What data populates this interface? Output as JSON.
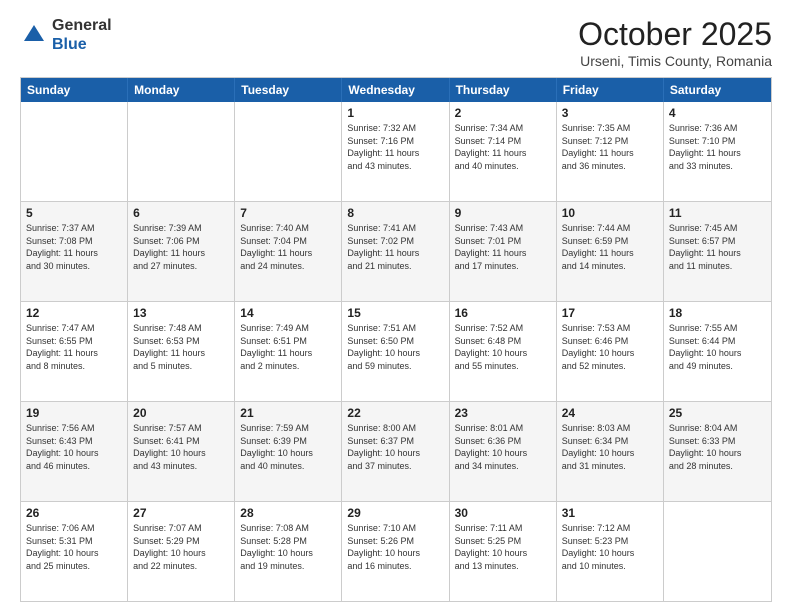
{
  "header": {
    "logo_general": "General",
    "logo_blue": "Blue",
    "title": "October 2025",
    "subtitle": "Urseni, Timis County, Romania"
  },
  "weekdays": [
    "Sunday",
    "Monday",
    "Tuesday",
    "Wednesday",
    "Thursday",
    "Friday",
    "Saturday"
  ],
  "weeks": [
    [
      {
        "day": "",
        "info": ""
      },
      {
        "day": "",
        "info": ""
      },
      {
        "day": "",
        "info": ""
      },
      {
        "day": "1",
        "info": "Sunrise: 7:32 AM\nSunset: 7:16 PM\nDaylight: 11 hours\nand 43 minutes."
      },
      {
        "day": "2",
        "info": "Sunrise: 7:34 AM\nSunset: 7:14 PM\nDaylight: 11 hours\nand 40 minutes."
      },
      {
        "day": "3",
        "info": "Sunrise: 7:35 AM\nSunset: 7:12 PM\nDaylight: 11 hours\nand 36 minutes."
      },
      {
        "day": "4",
        "info": "Sunrise: 7:36 AM\nSunset: 7:10 PM\nDaylight: 11 hours\nand 33 minutes."
      }
    ],
    [
      {
        "day": "5",
        "info": "Sunrise: 7:37 AM\nSunset: 7:08 PM\nDaylight: 11 hours\nand 30 minutes."
      },
      {
        "day": "6",
        "info": "Sunrise: 7:39 AM\nSunset: 7:06 PM\nDaylight: 11 hours\nand 27 minutes."
      },
      {
        "day": "7",
        "info": "Sunrise: 7:40 AM\nSunset: 7:04 PM\nDaylight: 11 hours\nand 24 minutes."
      },
      {
        "day": "8",
        "info": "Sunrise: 7:41 AM\nSunset: 7:02 PM\nDaylight: 11 hours\nand 21 minutes."
      },
      {
        "day": "9",
        "info": "Sunrise: 7:43 AM\nSunset: 7:01 PM\nDaylight: 11 hours\nand 17 minutes."
      },
      {
        "day": "10",
        "info": "Sunrise: 7:44 AM\nSunset: 6:59 PM\nDaylight: 11 hours\nand 14 minutes."
      },
      {
        "day": "11",
        "info": "Sunrise: 7:45 AM\nSunset: 6:57 PM\nDaylight: 11 hours\nand 11 minutes."
      }
    ],
    [
      {
        "day": "12",
        "info": "Sunrise: 7:47 AM\nSunset: 6:55 PM\nDaylight: 11 hours\nand 8 minutes."
      },
      {
        "day": "13",
        "info": "Sunrise: 7:48 AM\nSunset: 6:53 PM\nDaylight: 11 hours\nand 5 minutes."
      },
      {
        "day": "14",
        "info": "Sunrise: 7:49 AM\nSunset: 6:51 PM\nDaylight: 11 hours\nand 2 minutes."
      },
      {
        "day": "15",
        "info": "Sunrise: 7:51 AM\nSunset: 6:50 PM\nDaylight: 10 hours\nand 59 minutes."
      },
      {
        "day": "16",
        "info": "Sunrise: 7:52 AM\nSunset: 6:48 PM\nDaylight: 10 hours\nand 55 minutes."
      },
      {
        "day": "17",
        "info": "Sunrise: 7:53 AM\nSunset: 6:46 PM\nDaylight: 10 hours\nand 52 minutes."
      },
      {
        "day": "18",
        "info": "Sunrise: 7:55 AM\nSunset: 6:44 PM\nDaylight: 10 hours\nand 49 minutes."
      }
    ],
    [
      {
        "day": "19",
        "info": "Sunrise: 7:56 AM\nSunset: 6:43 PM\nDaylight: 10 hours\nand 46 minutes."
      },
      {
        "day": "20",
        "info": "Sunrise: 7:57 AM\nSunset: 6:41 PM\nDaylight: 10 hours\nand 43 minutes."
      },
      {
        "day": "21",
        "info": "Sunrise: 7:59 AM\nSunset: 6:39 PM\nDaylight: 10 hours\nand 40 minutes."
      },
      {
        "day": "22",
        "info": "Sunrise: 8:00 AM\nSunset: 6:37 PM\nDaylight: 10 hours\nand 37 minutes."
      },
      {
        "day": "23",
        "info": "Sunrise: 8:01 AM\nSunset: 6:36 PM\nDaylight: 10 hours\nand 34 minutes."
      },
      {
        "day": "24",
        "info": "Sunrise: 8:03 AM\nSunset: 6:34 PM\nDaylight: 10 hours\nand 31 minutes."
      },
      {
        "day": "25",
        "info": "Sunrise: 8:04 AM\nSunset: 6:33 PM\nDaylight: 10 hours\nand 28 minutes."
      }
    ],
    [
      {
        "day": "26",
        "info": "Sunrise: 7:06 AM\nSunset: 5:31 PM\nDaylight: 10 hours\nand 25 minutes."
      },
      {
        "day": "27",
        "info": "Sunrise: 7:07 AM\nSunset: 5:29 PM\nDaylight: 10 hours\nand 22 minutes."
      },
      {
        "day": "28",
        "info": "Sunrise: 7:08 AM\nSunset: 5:28 PM\nDaylight: 10 hours\nand 19 minutes."
      },
      {
        "day": "29",
        "info": "Sunrise: 7:10 AM\nSunset: 5:26 PM\nDaylight: 10 hours\nand 16 minutes."
      },
      {
        "day": "30",
        "info": "Sunrise: 7:11 AM\nSunset: 5:25 PM\nDaylight: 10 hours\nand 13 minutes."
      },
      {
        "day": "31",
        "info": "Sunrise: 7:12 AM\nSunset: 5:23 PM\nDaylight: 10 hours\nand 10 minutes."
      },
      {
        "day": "",
        "info": ""
      }
    ]
  ]
}
